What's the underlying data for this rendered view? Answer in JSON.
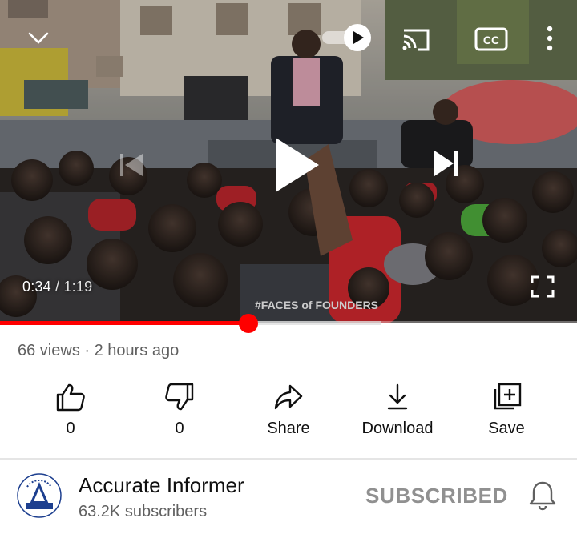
{
  "player": {
    "current_time": "0:34",
    "duration_text": "/ 1:19",
    "progress_fraction": 0.43,
    "buffer_fraction": 0.66,
    "accent_color": "#ff0000",
    "icons": {
      "collapse": "chevron-down-icon",
      "autoplay": "autoplay-toggle-icon",
      "cast": "cast-icon",
      "captions": "closed-captions-icon",
      "more": "more-vert-icon",
      "previous": "skip-previous-icon",
      "play": "play-icon",
      "next": "skip-next-icon",
      "fullscreen": "fullscreen-icon"
    },
    "captions_label": "CC",
    "shirt_print": "#FACES of FOUNDERS"
  },
  "video_meta": {
    "views_and_time": "66 views · 2 hours ago"
  },
  "actions": {
    "like": {
      "count": "0",
      "icon": "thumbs-up-icon"
    },
    "dislike": {
      "count": "0",
      "icon": "thumbs-down-icon"
    },
    "share": {
      "label": "Share",
      "icon": "share-icon"
    },
    "download": {
      "label": "Download",
      "icon": "download-icon"
    },
    "save": {
      "label": "Save",
      "icon": "add-to-playlist-icon"
    }
  },
  "channel": {
    "name": "Accurate Informer",
    "subscribers": "63.2K subscribers",
    "avatar_logo_text": "Accurate Informer",
    "subscribe_state": "SUBSCRIBED",
    "notification_icon": "bell-icon"
  }
}
